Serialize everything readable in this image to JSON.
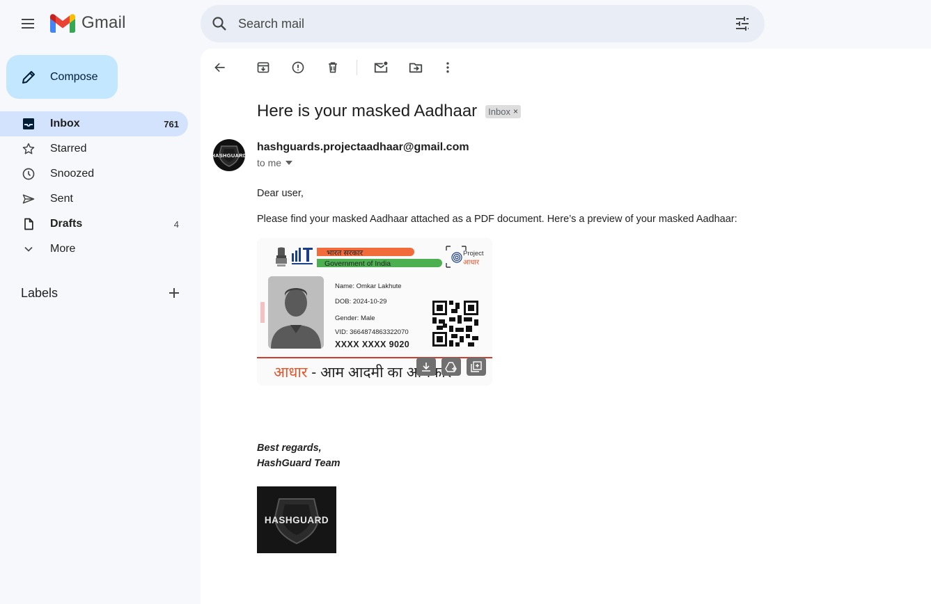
{
  "app": {
    "name": "Gmail",
    "menu_icon": "hamburger-menu-icon",
    "logo_icon": "gmail-m-logo-icon"
  },
  "search": {
    "placeholder": "Search mail",
    "value": "",
    "icon": "search-icon",
    "options_icon": "tune-icon"
  },
  "compose": {
    "label": "Compose",
    "icon": "pencil-icon"
  },
  "nav": {
    "items": [
      {
        "label": "Inbox",
        "count": "761",
        "icon": "inbox-icon",
        "active": true
      },
      {
        "label": "Starred",
        "count": "",
        "icon": "star-icon"
      },
      {
        "label": "Snoozed",
        "count": "",
        "icon": "clock-icon"
      },
      {
        "label": "Sent",
        "count": "",
        "icon": "send-icon"
      },
      {
        "label": "Drafts",
        "count": "4",
        "icon": "draft-icon"
      },
      {
        "label": "More",
        "count": "",
        "icon": "chevron-down-icon"
      }
    ]
  },
  "labels": {
    "title": "Labels",
    "add_icon": "plus-icon"
  },
  "toolbar": {
    "icons": [
      "back-arrow-icon",
      "archive-icon",
      "report-spam-icon",
      "delete-icon",
      "mark-unread-icon",
      "move-to-icon",
      "more-vert-icon"
    ]
  },
  "email": {
    "subject": "Here is your masked Aadhaar",
    "label_chip": "Inbox",
    "chip_close": "×",
    "sender": "hashguards.projectaadhaar@gmail.com",
    "recipient": "to me",
    "greeting": "Dear user,",
    "body": "Please find your masked Aadhaar attached as a PDF document. Here’s a preview of your masked Aadhaar:",
    "signoff_line1": "Best regards,",
    "signoff_line2": "HashGuard Team",
    "avatar_text": "HASHGUARD",
    "footer_logo_text": "HASHGUARD"
  },
  "aadhaar_card": {
    "gov_hindi": "भारत सरकार",
    "gov_english": "Government of India",
    "project_en": "Project",
    "project_hi": "आधार",
    "name": "Name: Omkar Lakhute",
    "dob": "DOB: 2024-10-29",
    "gender": "Gender: Male",
    "vid": "VID: 3664874863322070",
    "masked_number": "XXXX XXXX 9020",
    "slogan_aadhaar": "आधार",
    "slogan_rest": " - आम आदमी का अधिकार",
    "hover_icons": [
      "download-icon",
      "add-to-drive-icon",
      "add-to-photos-icon"
    ]
  },
  "colors": {
    "background": "#f6f8fc",
    "compose": "#c2e7ff",
    "active_nav": "#d3e3fd",
    "search": "#e9eef6",
    "aadhaar_orange": "#e2552a",
    "aadhaar_red_line": "#d03b30"
  }
}
